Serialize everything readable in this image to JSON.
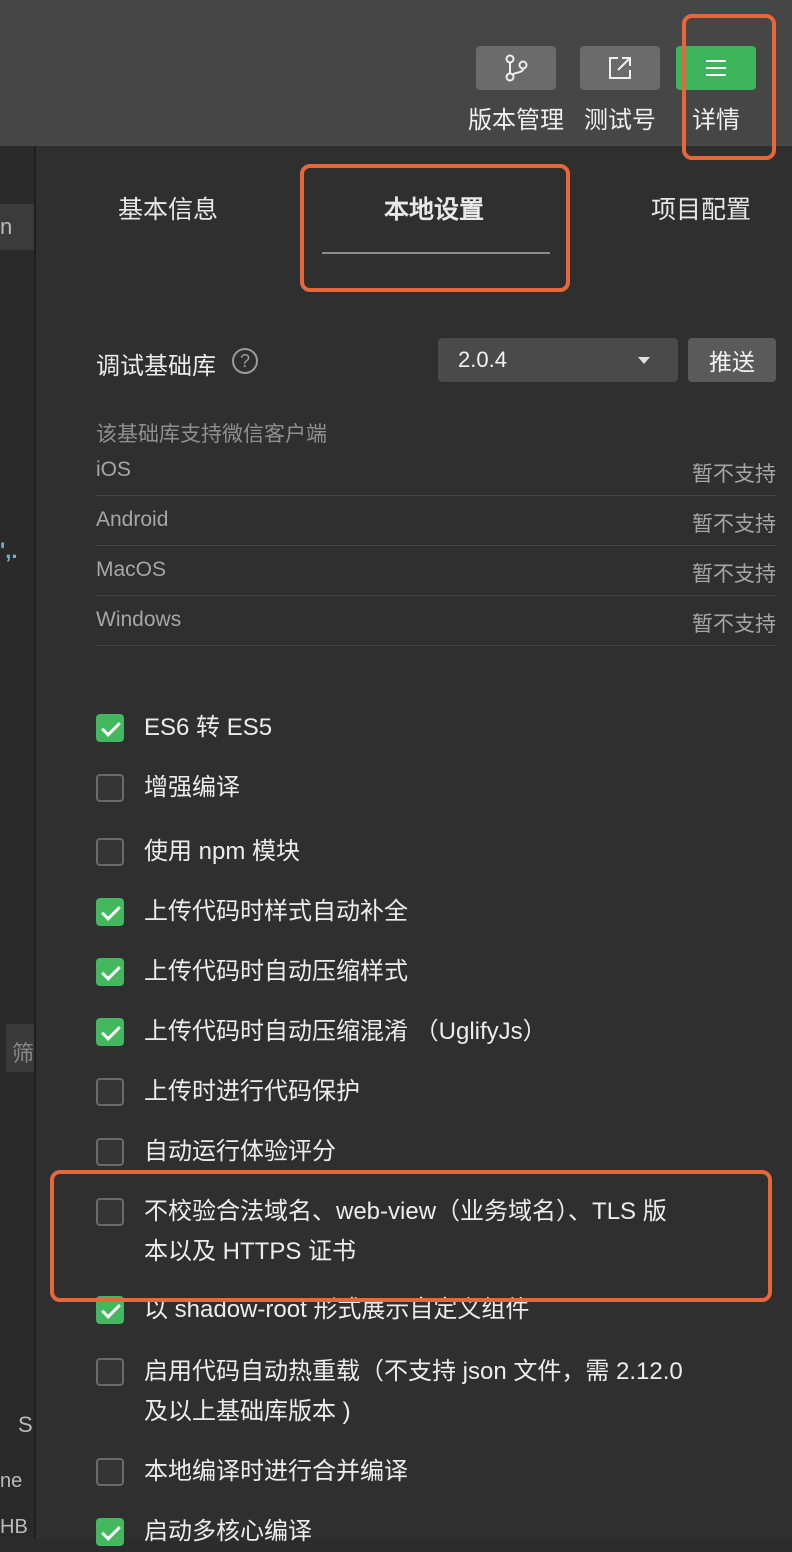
{
  "toolbar": {
    "buttons": [
      {
        "label": "版本管理",
        "icon": "branch-icon"
      },
      {
        "label": "测试号",
        "icon": "external-link-icon"
      },
      {
        "label": "详情",
        "icon": "menu-icon"
      }
    ]
  },
  "left_fragments": [
    "n",
    "',.",
    "筛",
    "S",
    "ne",
    "HB"
  ],
  "tabs": [
    "基本信息",
    "本地设置",
    "项目配置"
  ],
  "active_tab": "本地设置",
  "debug_lib": {
    "label": "调试基础库",
    "help_icon": "?",
    "version": "2.0.4",
    "push_label": "推送"
  },
  "clients": {
    "title": "该基础库支持微信客户端",
    "rows": [
      {
        "name": "iOS",
        "status": "暂不支持"
      },
      {
        "name": "Android",
        "status": "暂不支持"
      },
      {
        "name": "MacOS",
        "status": "暂不支持"
      },
      {
        "name": "Windows",
        "status": "暂不支持"
      }
    ]
  },
  "options": [
    {
      "label": "ES6 转 ES5",
      "checked": true
    },
    {
      "label": "增强编译",
      "checked": false
    },
    {
      "label": "使用 npm 模块",
      "checked": false
    },
    {
      "label": "上传代码时样式自动补全",
      "checked": true
    },
    {
      "label": "上传代码时自动压缩样式",
      "checked": true
    },
    {
      "label": "上传代码时自动压缩混淆 （UglifyJs）",
      "checked": true
    },
    {
      "label": "上传时进行代码保护",
      "checked": false
    },
    {
      "label": "自动运行体验评分",
      "checked": false
    },
    {
      "label": "不校验合法域名、web-view（业务域名）、TLS 版",
      "label2": "本以及 HTTPS 证书",
      "checked": false
    },
    {
      "label": "以 shadow-root 形式展示自定义组件",
      "checked": true
    },
    {
      "label": "启用代码自动热重载（不支持 json 文件，需 2.12.0",
      "label2": "及以上基础库版本 )",
      "checked": false
    },
    {
      "label": "本地编译时进行合并编译",
      "checked": false
    },
    {
      "label": "启动多核心编译",
      "checked": true
    }
  ],
  "colors": {
    "accent": "#3fb55b",
    "highlight": "#e8673a"
  }
}
